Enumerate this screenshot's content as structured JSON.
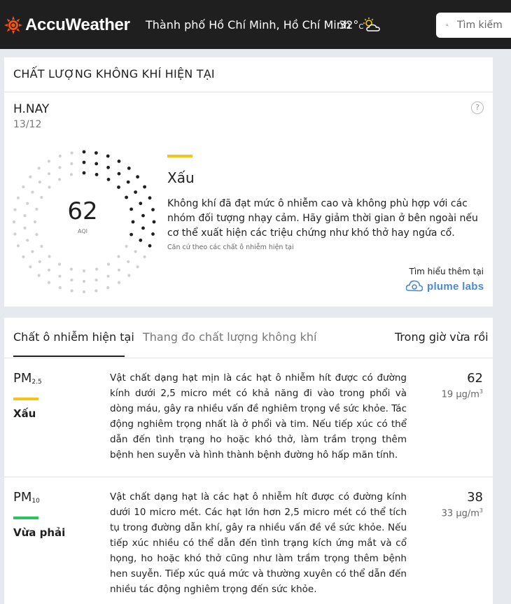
{
  "header": {
    "brand": "AccuWeather",
    "location": "Thành phố Hồ Chí Minh, Hồ Chí Minh",
    "temp_value": "32°",
    "temp_unit": "C",
    "weather_icon": "partly-sunny-icon",
    "search_placeholder": "Tìm kiếm"
  },
  "current": {
    "section_title": "CHẤT LƯỢNG KHÔNG KHÍ HIỆN TẠI",
    "day_label": "H.NAY",
    "date": "13/12",
    "help_glyph": "?",
    "aqi_value": "62",
    "aqi_label": "AQI",
    "aqi_fraction": 0.31,
    "category": "Xấu",
    "category_color": "#f3c518",
    "description": "Không khí đã đạt mức ô nhiễm cao và không phù hợp với các nhóm đối tượng nhạy cảm. Hãy giảm thời gian ở bên ngoài nếu cơ thể xuất hiện các triệu chứng như khó thở hay ngứa cổ.",
    "note": "Căn cứ theo các chất ô nhiễm hiện tại",
    "learn_more": "Tìm hiểu thêm tại",
    "partner": "plume labs"
  },
  "tabs": {
    "pollutants": "Chất ô nhiễm hiện tại",
    "scale": "Thang đo chất lượng không khí",
    "past_hour": "Trong giờ vừa rồi"
  },
  "pollutants": [
    {
      "name": "PM",
      "sub": "2.5",
      "bar_color": "#f3c518",
      "category": "Xấu",
      "description": "Vật chất dạng hạt mịn là các hạt ô nhiễm hít được có đường kính dưới 2,5 micro mét có khả năng đi vào trong phổi và dòng máu, gây ra nhiều vấn đề nghiêm trọng về sức khỏe. Tác động nghiêm trọng nhất là ở phổi và tim. Nếu tiếp xúc có thể dẫn đến tình trạng ho hoặc khó thở, làm trầm trọng thêm bệnh hen suyễn và hình thành bệnh đường hô hấp mãn tính.",
      "value": "62",
      "concentration": "19 µg/m",
      "unit_sup": "3"
    },
    {
      "name": "PM",
      "sub": "10",
      "bar_color": "#29c361",
      "category": "Vừa phải",
      "description": "Vật chất dạng hạt là các hạt ô nhiễm hít được có đường kính dưới 10 micro mét. Các hạt lớn hơn 2,5 micro mét có thể tích tụ trong đường dẫn khí, gây ra nhiều vấn đề về sức khỏe. Nếu tiếp xúc nhiều có thể dẫn đến tình trạng kích ứng mắt và cổ họng, ho hoặc khó thở cũng như làm trầm trọng thêm bệnh hen suyễn. Tiếp xúc quá mức và thường xuyên có thể dẫn đến nhiều tác động nghiêm trọng đến sức khỏe.",
      "value": "38",
      "concentration": "33 µg/m",
      "unit_sup": "3"
    }
  ]
}
